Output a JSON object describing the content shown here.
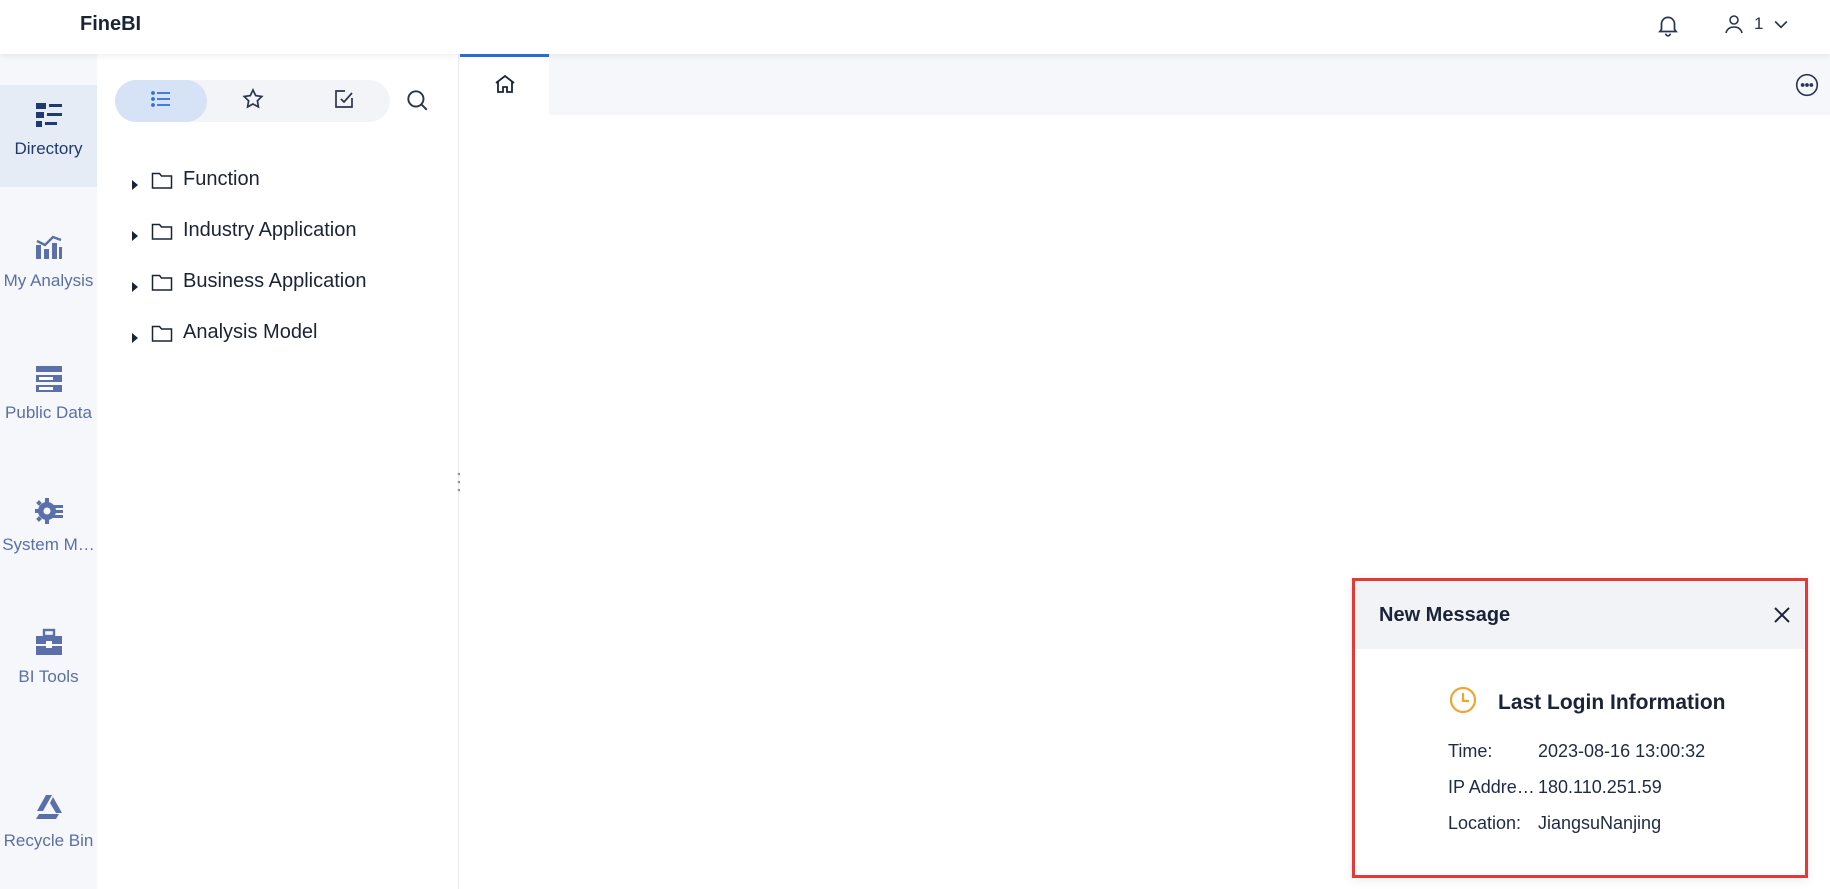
{
  "app": {
    "brand": "FineBI"
  },
  "header": {
    "user_label": "1"
  },
  "leftnav": {
    "items": [
      {
        "label": "Directory",
        "icon": "directory-icon",
        "active": true
      },
      {
        "label": "My Analysis",
        "icon": "my-analysis-icon",
        "active": false
      },
      {
        "label": "Public Data",
        "icon": "public-data-icon",
        "active": false
      },
      {
        "label": "System M…",
        "icon": "system-management-icon",
        "active": false
      },
      {
        "label": "BI Tools",
        "icon": "bi-tools-icon",
        "active": false
      },
      {
        "label": "Recycle Bin",
        "icon": "recycle-bin-icon",
        "active": false
      }
    ]
  },
  "directory": {
    "tree": [
      {
        "label": "Function"
      },
      {
        "label": "Industry Application"
      },
      {
        "label": "Business Application"
      },
      {
        "label": "Analysis Model"
      }
    ]
  },
  "message": {
    "title": "New Message",
    "heading": "Last Login Information",
    "rows": [
      {
        "key": "Time:",
        "value": "2023-08-16 13:00:32"
      },
      {
        "key": "IP Addre…",
        "value": "180.110.251.59"
      },
      {
        "key": "Location:",
        "value": "JiangsuNanjing"
      }
    ]
  },
  "colors": {
    "accent": "#2f6fd6",
    "nav_icon": "#5b6fa8",
    "nav_active_bg": "#e6ecf6",
    "highlight_border": "#e53935",
    "clock": "#f0a431"
  }
}
